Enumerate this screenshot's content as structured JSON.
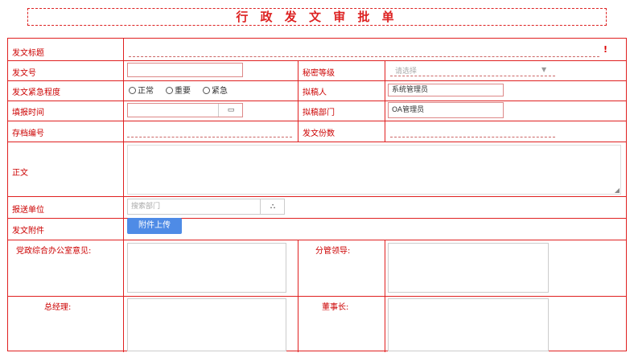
{
  "title": "行 政 发 文 审 批 单",
  "labels": {
    "subject": "发文标题",
    "doc_no": "发文号",
    "secrecy": "秘密等级",
    "urgency": "发文紧急程度",
    "drafter": "拟稿人",
    "fill_time": "填报时间",
    "draft_dept": "拟稿部门",
    "archive_no": "存档编号",
    "copies": "发文份数",
    "body": "正文",
    "send_to": "报送单位",
    "attachment": "发文附件",
    "office_opinion": "党政综合办公室意见:",
    "leader": "分管领导:",
    "gm": "总经理:",
    "chairman": "董事长:"
  },
  "required_mark": "!",
  "secrecy_select": {
    "placeholder": "请选择"
  },
  "urgency_options": [
    "正常",
    "重要",
    "紧急"
  ],
  "drafter_value": "系统管理员",
  "draft_dept_value": "OA管理员",
  "send_to_placeholder": "搜索部门",
  "upload_button": "附件上传",
  "icons": {
    "calendar": "calendar-icon",
    "org_tree": "org-tree-icon",
    "dropdown": "chevron-down-icon",
    "resize": "resize-handle-icon"
  }
}
